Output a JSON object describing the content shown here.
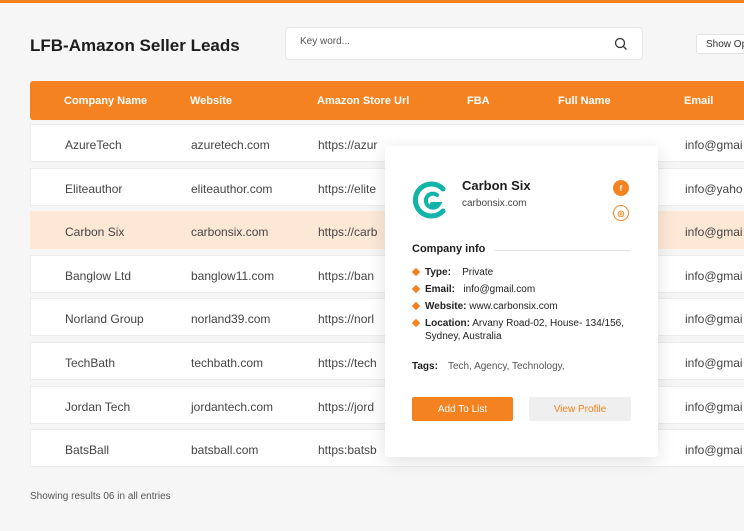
{
  "page": {
    "title": "LFB-Amazon Seller Leads",
    "search_placeholder": "Key word...",
    "show_label": "Show Options",
    "footer": "Showing results 06 in all entries"
  },
  "colors": {
    "accent": "#f58220",
    "selected_row": "#fde8d6"
  },
  "table": {
    "columns": [
      "Company Name",
      "Website",
      "Amazon Store Url",
      "FBA",
      "Full Name",
      "Email"
    ],
    "rows": [
      {
        "company": "AzureTech",
        "website": "azuretech.com",
        "store": "https://azur",
        "email": "info@gmai"
      },
      {
        "company": "Eliteauthor",
        "website": "eliteauthor.com",
        "store": "https://elite",
        "email": "info@yaho"
      },
      {
        "company": "Carbon Six",
        "website": "carbonsix.com",
        "store": "https://carb",
        "email": "info@gmai"
      },
      {
        "company": "Banglow Ltd",
        "website": "banglow11.com",
        "store": "https://ban",
        "email": "info@gmai"
      },
      {
        "company": "Norland Group",
        "website": "norland39.com",
        "store": "https://norl",
        "email": "info@gmai"
      },
      {
        "company": "TechBath",
        "website": "techbath.com",
        "store": "https://tech",
        "email": "info@gmai"
      },
      {
        "company": "Jordan Tech",
        "website": "jordantech.com",
        "store": "https://jord",
        "email": "info@gmai"
      },
      {
        "company": "BatsBall",
        "website": "batsball.com",
        "store": "https:batsb",
        "email": "info@gmai"
      }
    ],
    "selected_row": 2
  },
  "popup": {
    "name": "Carbon Six",
    "website": "carbonsix.com",
    "logo_icon": "carbon-six-logo",
    "social_icons": [
      "facebook-icon",
      "instagram-icon"
    ],
    "section_title": "Company info",
    "type_label": "Type:",
    "type_value": "Private",
    "email_label": "Email:",
    "email_value": "info@gmail.com",
    "website_label": "Website:",
    "website_value": "www.carbonsix.com",
    "location_label": "Location:",
    "location_value": "Arvany Road-02, House- 134/156, Sydney, Australia",
    "tags_label": "Tags:",
    "tags_value": "Tech,  Agency,  Technology,",
    "add_button": "Add To List",
    "view_button": "View Profile"
  }
}
